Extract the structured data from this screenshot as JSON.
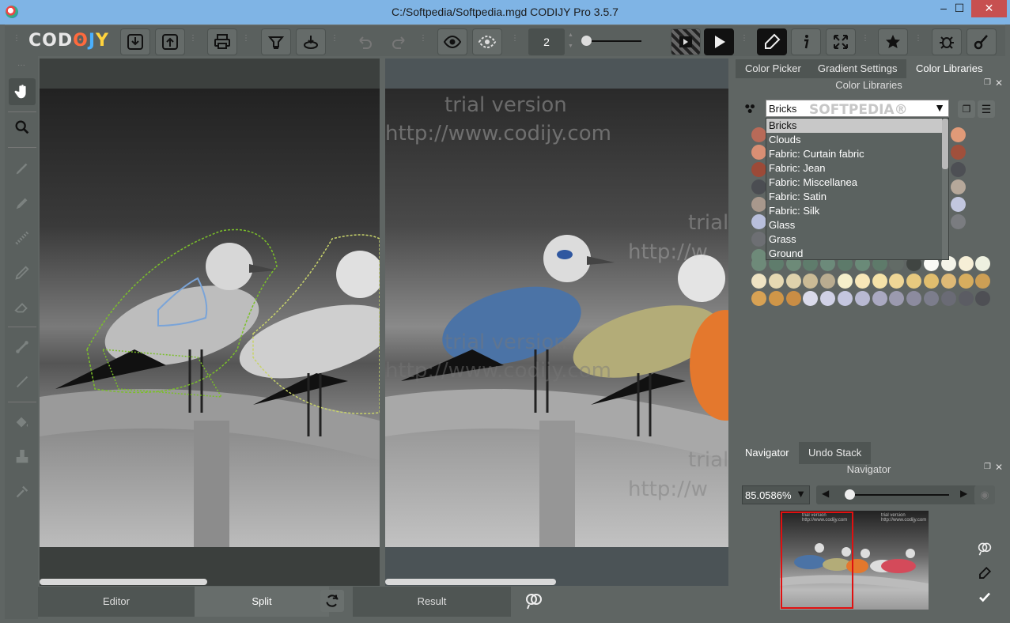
{
  "window": {
    "title": "C:/Softpedia/Softpedia.mgd CODIJY Pro 3.5.7",
    "minimize": "‒",
    "maximize": "☐",
    "close": "✕"
  },
  "logo": {
    "p1": "COD",
    "p2": "ʘ",
    "p3": "J",
    "p4": "Y"
  },
  "toolbar": {
    "icons": [
      "import-icon",
      "export-icon",
      "print-icon",
      "colorize-icon",
      "recolor-icon",
      "undo-icon",
      "redo-icon",
      "preview-icon",
      "onion-skin-icon",
      "play-frames-icon",
      "play-icon",
      "pen-tool-icon",
      "info-icon",
      "fullscreen-icon",
      "favorites-icon",
      "bug-report-icon",
      "settings-icon"
    ],
    "frame_number": "2"
  },
  "canvas": {
    "watermark_line1": "trial version",
    "watermark_line2": "http://www.codijy.com",
    "watermark_trial": "trial",
    "watermark_http": "http://w"
  },
  "bottom_tabs": {
    "editor": "Editor",
    "split": "Split",
    "result": "Result"
  },
  "color_tabs": [
    "Color Picker",
    "Gradient Settings",
    "Color Libraries"
  ],
  "color_libraries": {
    "header": "Color Libraries",
    "selected": "Bricks",
    "options": [
      "Bricks",
      "Clouds",
      "Fabric: Curtain fabric",
      "Fabric: Jean",
      "Fabric: Miscellanea",
      "Fabric: Satin",
      "Fabric: Silk",
      "Glass",
      "Grass",
      "Ground"
    ],
    "watermark": "SOFTPEDIA®"
  },
  "swatch_colors": {
    "left_column": [
      "#b86a58",
      "#d98f74",
      "#9c4a38",
      "#4b4d52",
      "#a8988c",
      "#b8bfdc",
      "#6d6f73",
      "#6e8a79"
    ],
    "right_column": [
      "#e09a78",
      "#a0503c",
      "#4d4f54",
      "#b6a89a",
      "#c2c7df",
      "#7a7c80",
      "#5e7a6b"
    ],
    "row_a": [
      "#6e8a79",
      "#5f7c6c",
      "#6d8a78",
      "#5f7c6c",
      "#6c8a7a",
      "#5d7a6a",
      "#6a8a78",
      "#5e7a6a",
      "#626b66",
      "#404542",
      "#fafaf6",
      "#f3f3e8",
      "#f6efd7",
      "#eef1e0"
    ],
    "row_b": [
      "#efe3c3",
      "#e6d9b3",
      "#dfd2ac",
      "#cbbb96",
      "#b9ac90",
      "#f5efcb",
      "#f8e7b8",
      "#f5e2a8",
      "#efd696",
      "#e7c97f",
      "#e0bd6e",
      "#deb976",
      "#d7ad5e",
      "#cd9f55"
    ],
    "row_c": [
      "#d8a254",
      "#cf9648",
      "#c98d45",
      "#dadbeb",
      "#d0d1e6",
      "#c4c6df",
      "#b8b9d2",
      "#aaa9c1",
      "#9b9aaf",
      "#8c8b9f",
      "#7c7d8c",
      "#6a6b75",
      "#5b5c63",
      "#4e4f54"
    ]
  },
  "nav_tabs": [
    "Navigator",
    "Undo Stack"
  ],
  "navigator": {
    "header": "Navigator",
    "zoom": "85.0586%",
    "thumb_watermark": "trial version http://www.codijy.com"
  }
}
